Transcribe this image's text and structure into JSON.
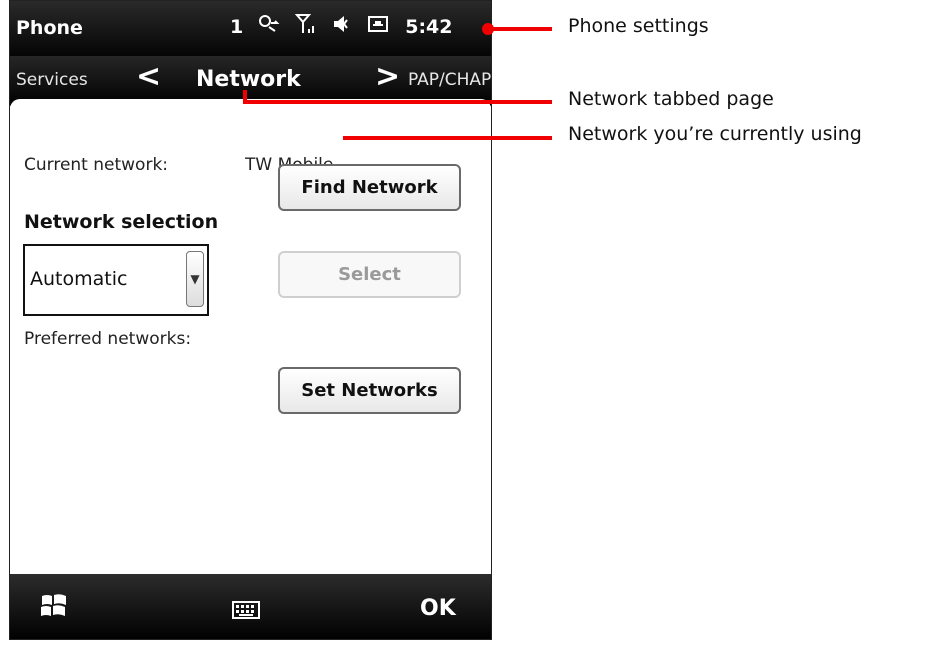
{
  "status": {
    "title": "Phone",
    "notification_count": "1",
    "time": "5:42"
  },
  "tabs": {
    "prev": "Services",
    "current": "Network",
    "next": "PAP/CHAP"
  },
  "current_network": {
    "label": "Current network:",
    "value": "TW Mobile"
  },
  "buttons": {
    "find": "Find Network",
    "select": "Select",
    "set": "Set Networks"
  },
  "network_selection": {
    "heading": "Network selection",
    "selected": "Automatic"
  },
  "preferred": {
    "label": "Preferred networks:"
  },
  "softkeys": {
    "ok": "OK"
  },
  "annotations": [
    "Phone settings",
    "Network tabbed page",
    "Network you’re currently using"
  ],
  "colors": {
    "annotation": "#f00000"
  }
}
